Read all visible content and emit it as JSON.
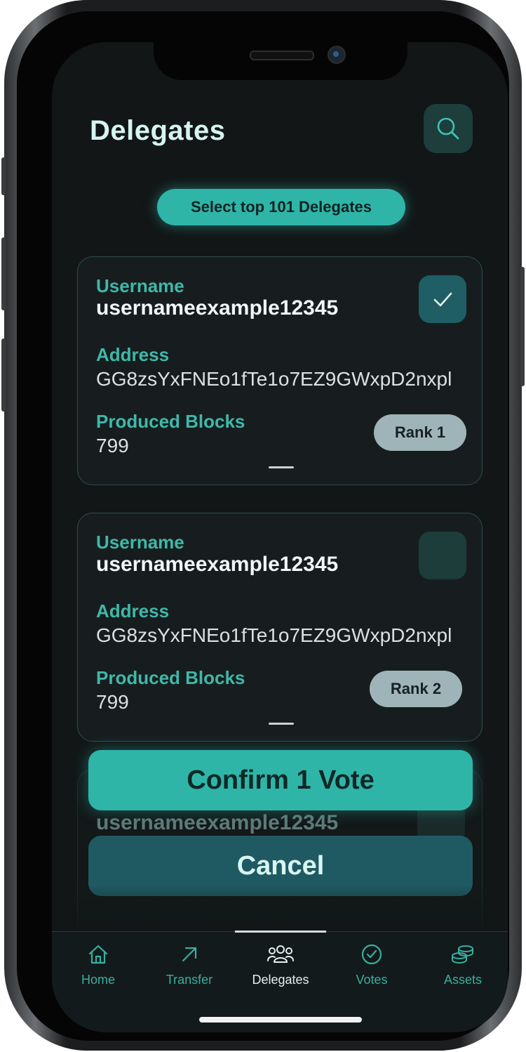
{
  "header": {
    "title": "Delegates"
  },
  "select_top_label": "Select top 101 Delegates",
  "labels": {
    "username": "Username",
    "address": "Address",
    "produced_blocks": "Produced Blocks"
  },
  "delegates": [
    {
      "username": "usernameexample12345",
      "address": "GG8zsYxFNEo1fTe1o7EZ9GWxpD2nxpl",
      "produced_blocks": "799",
      "rank": "Rank 1",
      "selected": true
    },
    {
      "username": "usernameexample12345",
      "address": "GG8zsYxFNEo1fTe1o7EZ9GWxpD2nxpl",
      "produced_blocks": "799",
      "rank": "Rank 2",
      "selected": false
    },
    {
      "username": "usernameexample12345"
    }
  ],
  "actions": {
    "confirm": "Confirm 1 Vote",
    "cancel": "Cancel"
  },
  "tabs": [
    {
      "label": "Home",
      "icon": "home-icon"
    },
    {
      "label": "Transfer",
      "icon": "arrow-up-right-icon"
    },
    {
      "label": "Delegates",
      "icon": "users-icon",
      "active": true
    },
    {
      "label": "Votes",
      "icon": "check-circle-icon"
    },
    {
      "label": "Assets",
      "icon": "coins-icon"
    }
  ],
  "colors": {
    "accent": "#2fb5a8",
    "background": "#121617",
    "card": "#171d1e",
    "cancel": "#1f5a62"
  }
}
